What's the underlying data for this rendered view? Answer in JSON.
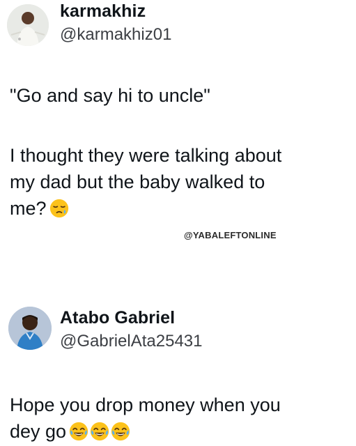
{
  "posts": [
    {
      "display_name": "karmakhiz",
      "handle": "@karmakhiz01",
      "avatar_icon": "profile-photo-avatar",
      "quote_line": "\"Go and say hi to uncle\"",
      "body_lines": [
        "I thought they were talking about",
        "my dad but the baby walked to",
        "me?"
      ],
      "emojis": [
        "sleepy-face-emoji"
      ]
    },
    {
      "display_name": "Atabo Gabriel",
      "handle": "@GabrielAta25431",
      "avatar_icon": "profile-photo-avatar",
      "body_lines": [
        "Hope you drop money when you",
        "dey go"
      ],
      "emojis": [
        "tears-of-joy-emoji",
        "tears-of-joy-emoji",
        "tears-of-joy-emoji"
      ]
    }
  ],
  "watermark": "@YABALEFTONLINE",
  "colors": {
    "text": "#0f1419",
    "handle": "#3c3f44",
    "emoji_yellow": "#fcc21b"
  }
}
